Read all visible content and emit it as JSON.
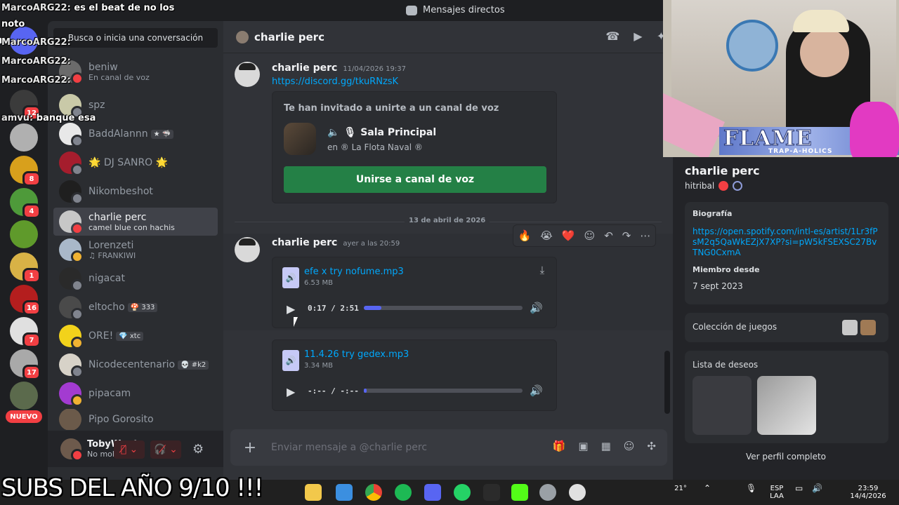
{
  "titlebar": {
    "title": "Mensajes directos"
  },
  "servers": [
    {
      "badge": "",
      "color": "#5865f2"
    },
    {
      "badge": "12",
      "color": "#3b3b3b"
    },
    {
      "badge": "",
      "color": "#b0b0b0"
    },
    {
      "badge": "8",
      "color": "#d8a01c"
    },
    {
      "badge": "4",
      "color": "#4e9a3a"
    },
    {
      "badge": "",
      "color": "#5f9a2b"
    },
    {
      "badge": "1",
      "color": "#d8b246"
    },
    {
      "badge": "16",
      "color": "#b41e1e"
    },
    {
      "badge": "7",
      "color": "#e0e0e0"
    },
    {
      "badge": "17",
      "color": "#a9a9a9"
    },
    {
      "badge": "",
      "color": "#5b6a4c"
    }
  ],
  "server_new_label": "NUEVO",
  "search": {
    "placeholder": "Busca o inicia una conversación"
  },
  "dms": [
    {
      "name": "beniw",
      "sub": "En canal de voz",
      "status": "dnd",
      "avatar_color": "#6b6b6b"
    },
    {
      "name": "spz",
      "sub": "",
      "status": "offline",
      "avatar_color": "#c9c9a8"
    },
    {
      "name": "BaddAlannn",
      "tag": "★ 🦈",
      "sub": "",
      "status": "offline",
      "avatar_color": "#e8e8e8"
    },
    {
      "name": "🌟 DJ SANRO 🌟",
      "sub": "",
      "status": "offline",
      "avatar_color": "#a51d2d"
    },
    {
      "name": "Nikombeshot",
      "sub": "",
      "status": "offline",
      "avatar_color": "#1f1f1f"
    },
    {
      "name": "charlie perc",
      "sub": "camel blue con hachis",
      "status": "dnd",
      "avatar_color": "#c7c7c7"
    },
    {
      "name": "Lorenzeti",
      "sub": "♫ FRANKIWI",
      "status": "idle",
      "avatar_color": "#a9b8c9"
    },
    {
      "name": "nigacat",
      "sub": "",
      "status": "offline",
      "avatar_color": "#2a2a2a"
    },
    {
      "name": "eltocho",
      "tag": "🍄 333",
      "sub": "",
      "status": "offline",
      "avatar_color": "#4a4a4a"
    },
    {
      "name": "ORE!",
      "tag": "💎 xtc",
      "sub": "",
      "status": "idle",
      "avatar_color": "#f2d21b"
    },
    {
      "name": "Nicodecentenario",
      "tag": "💀 #k2",
      "sub": "",
      "status": "offline",
      "avatar_color": "#d7d2c8"
    },
    {
      "name": "pipacam",
      "sub": "",
      "status": "idle",
      "avatar_color": "#a33bd1"
    },
    {
      "name": "Pipo Gorosito",
      "sub": "",
      "status": "offline",
      "avatar_color": "#6b5a4a"
    }
  ],
  "user_panel": {
    "name": "TobyWuet",
    "status": "No molestar"
  },
  "chat": {
    "header_name": "charlie perc",
    "messages": [
      {
        "author": "charlie perc",
        "time": "11/04/2026 19:37",
        "link": "https://discord.gg/tkuRNzsK",
        "invite": {
          "title": "Te han invitado a unirte a un canal de voz",
          "channel": "Sala Principal",
          "server": "en ® La Flota Naval ®",
          "button": "Unirse a canal de voz"
        }
      }
    ],
    "date_divider": "13 de abril de 2026",
    "message2": {
      "author": "charlie perc",
      "time": "ayer a las 20:59"
    },
    "reactions": [
      "🔥",
      "😭",
      "❤️"
    ],
    "attachments": [
      {
        "name": "efe x try nofume.mp3",
        "size": "6.53 MB",
        "time": "0:17 / 2:51",
        "progress": 0.11
      },
      {
        "name": "11.4.26 try gedex.mp3",
        "size": "3.34 MB",
        "time": "-:-- / -:--",
        "progress": 0.0
      }
    ],
    "composer_placeholder": "Enviar mensaje a @charlie perc"
  },
  "profile": {
    "name": "charlie perc",
    "username": "hitribal",
    "bio_label": "Biografía",
    "bio_link": "https://open.spotify.com/intl-es/artist/1Lr3fPsM2q5QaWkEZjX7XP?si=pW5kFSEXSC27BvTNG0CxmA",
    "member_since_label": "Miembro desde",
    "member_since": "7 sept 2023",
    "games_label": "Colección de juegos",
    "wishlist_label": "Lista de deseos",
    "view_full": "Ver perfil completo"
  },
  "stream": {
    "overlay_text": "FLAME",
    "overlay_sub": "TRAP-A-HOLICS"
  },
  "stream_chat": [
    {
      "user": "MarcoARG22:",
      "text": " es el beat de no los"
    },
    {
      "user": "",
      "text": "noto"
    },
    {
      "user": "MarcoARG22:",
      "text": ""
    },
    {
      "user": "MarcoARG22:",
      "text": ""
    },
    {
      "user": "MarcoARG22:",
      "text": ""
    },
    {
      "user": "amvu:",
      "text": " banque esa"
    }
  ],
  "taskbar": {
    "weather": "21°",
    "lang_top": "ESP",
    "lang_bottom": "LAA",
    "clock_time": "23:59",
    "clock_date": "14/4/2026"
  },
  "caption": "SUBS DEL AÑO 9/10 !!!"
}
